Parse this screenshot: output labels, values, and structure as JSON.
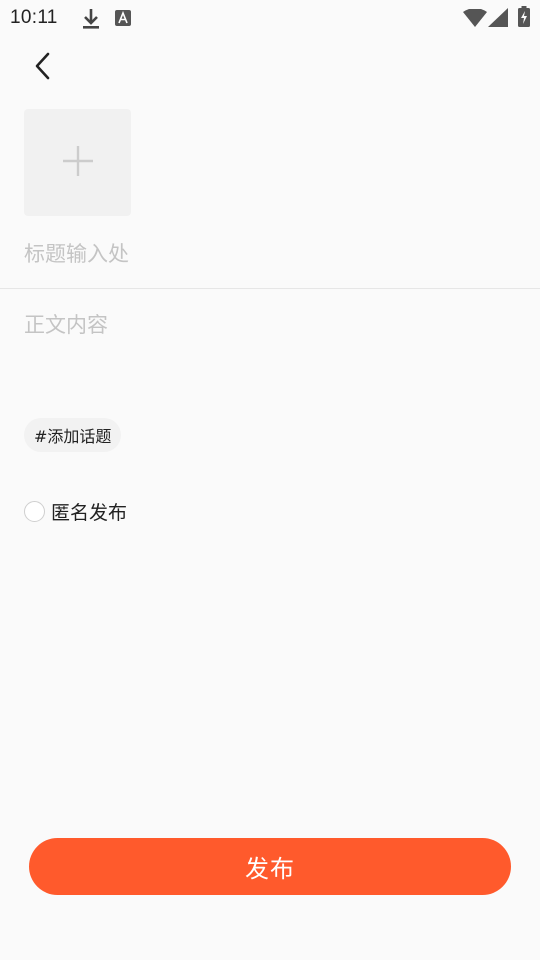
{
  "status_bar": {
    "time": "10:11",
    "icons": [
      "download-icon",
      "keyboard-a-icon",
      "wifi-icon",
      "signal-icon",
      "battery-charging-icon"
    ]
  },
  "header": {
    "back_icon": "chevron-left-icon"
  },
  "image_picker": {
    "icon": "plus-icon"
  },
  "title": {
    "placeholder": "标题输入处",
    "value": ""
  },
  "body": {
    "placeholder": "正文内容",
    "value": ""
  },
  "topic": {
    "label": "#添加话题"
  },
  "anonymous": {
    "label": "匿名发布",
    "checked": false
  },
  "publish": {
    "label": "发布"
  },
  "colors": {
    "accent": "#ff5a2c",
    "background": "#fafafa",
    "placeholder": "#c4c4c4"
  }
}
